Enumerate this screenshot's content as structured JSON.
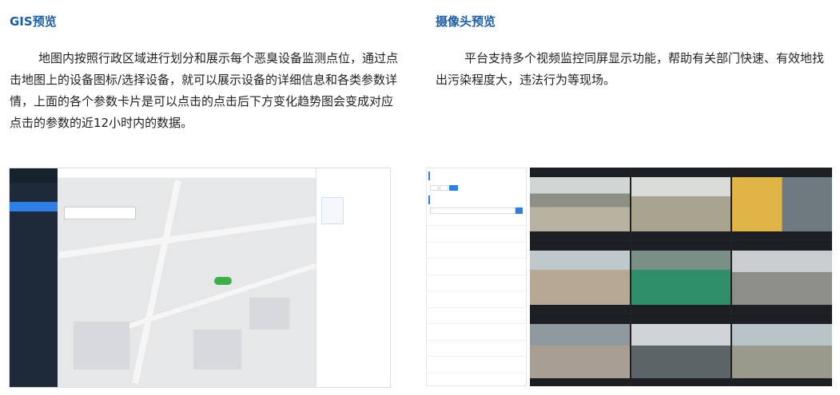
{
  "left": {
    "title": "GIS预览",
    "paragraph": "地图内按照行政区域进行划分和展示每个恶臭设备监测点位，通过点击地图上的设备图标/选择设备，就可以展示设备的详细信息和各类参数详情，上面的各个参数卡片是可以点击的点击后下方变化趋势图会变成对应点击的参数的近12小时内的数据。"
  },
  "right": {
    "title": "摄像头预览",
    "paragraph": "平台支持多个视频监控同屏显示功能，帮助有关部门快速、有效地找出污染程度大，违法行为等现场。"
  }
}
